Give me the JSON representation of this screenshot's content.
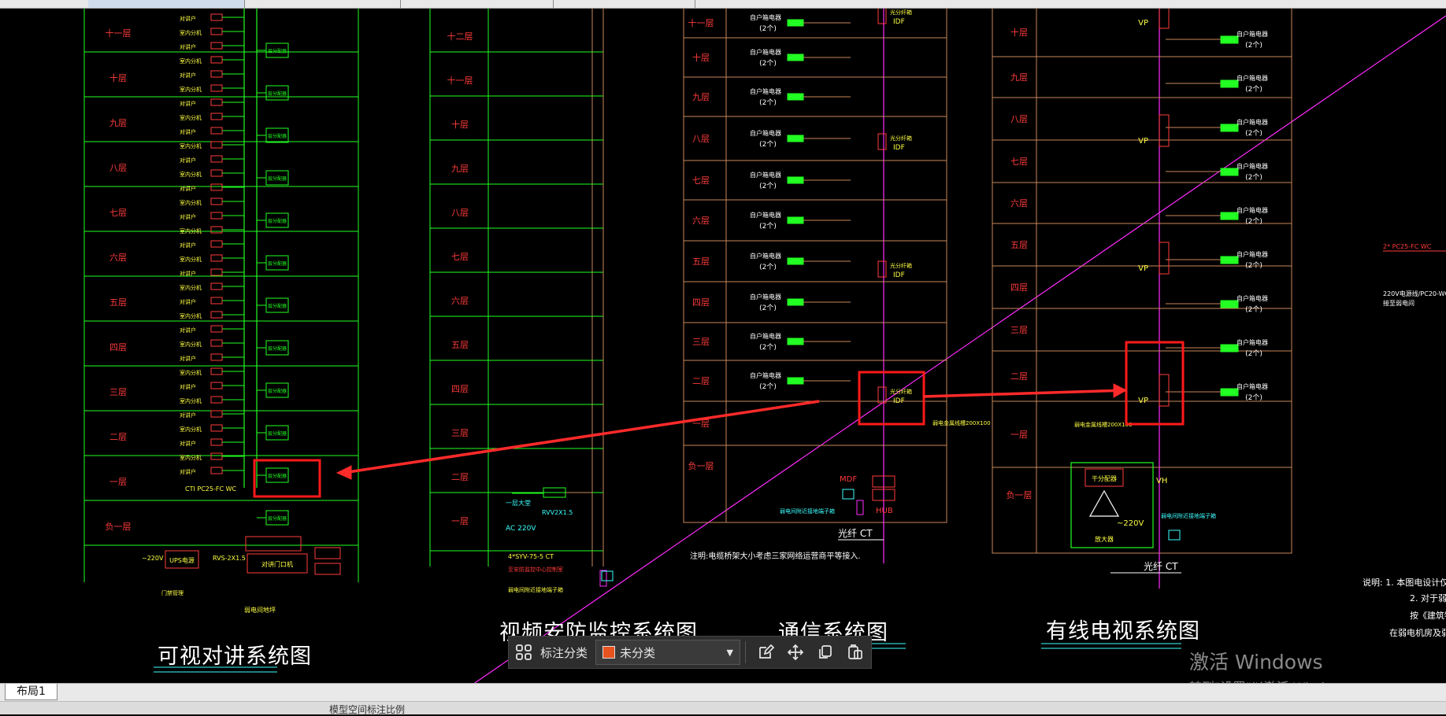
{
  "top_tabs": [
    "",
    "",
    "",
    "",
    ""
  ],
  "diagrams": {
    "intercom": {
      "title": "可视对讲系统图",
      "floors": [
        "十一层",
        "十层",
        "九层",
        "八层",
        "七层",
        "六层",
        "五层",
        "四层",
        "三层",
        "二层",
        "一层",
        "负一层"
      ],
      "component_labels": [
        "室内分机",
        "对讲户",
        "层分配器"
      ],
      "bottom_labels": [
        "UPS电源",
        "对讲门口机",
        "CTI PC25-FC WC",
        "楼层配电箱",
        "弱电间地坪",
        "RVS-2X1.5",
        "~220V",
        "门禁管理"
      ]
    },
    "cctv": {
      "title": "视频安防监控系统图",
      "floors": [
        "十二层",
        "十一层",
        "十层",
        "九层",
        "八层",
        "七层",
        "六层",
        "五层",
        "四层",
        "三层",
        "二层",
        "一层"
      ],
      "labels": [
        "一层大堂",
        "RVV2X1.5",
        "AC 220V",
        "4*SYV-75-5 CT",
        "至安防监控中心控制室",
        "弱电间附近接地端子箱"
      ]
    },
    "telecom": {
      "title": "通信系统图",
      "floors": [
        "十一层",
        "十层",
        "九层",
        "八层",
        "七层",
        "六层",
        "五层",
        "四层",
        "三层",
        "二层",
        "一层",
        "负一层"
      ],
      "outlet_label": "自户箱电器",
      "outlet_count": "(2个)",
      "idf_label": "IDF",
      "mdf_label": "MDF",
      "hub_label": "HUB",
      "tap_label": "光分纤箱",
      "note": "注明:电缆桥架大小考虑三家网络运营商平等接入.",
      "fiber_label": "光纤 CT",
      "riser_label": "弱电金属线槽200X100",
      "ground_label": "弱电间附近接地端子箱"
    },
    "catv": {
      "title": "有线电视系统图",
      "floors": [
        "十层",
        "九层",
        "八层",
        "七层",
        "六层",
        "五层",
        "四层",
        "三层",
        "二层",
        "一层",
        "负一层"
      ],
      "outlet_label": "自户箱电器",
      "outlet_count": "(2个)",
      "vp_label": "VP",
      "vh_label": "VH",
      "amp_label": "干分配器",
      "power_label": "~220V",
      "amp_box_label": "放大器",
      "fiber_label": "光纤 CT",
      "riser_label": "弱电金属线槽200X100",
      "ground_label": "弱电间附近接地端子箱"
    },
    "right_notes": [
      "2* PC25-FC WC",
      "220V电源线/PC20-WC",
      "接至弱电间",
      "说明: 1. 本图电设计仅为参",
      "2. 对于弱电系统电子",
      "按《建筑物电子信息",
      "在弱电机房及弱电间"
    ]
  },
  "context_toolbar": {
    "annotate_label": "标注分类",
    "category_value": "未分类",
    "category_color": "#e8531f"
  },
  "layout_tab": "布局1",
  "status_text": "模型空间标注比例",
  "watermark": {
    "line1": "激活 Windows",
    "line2": "转到\"设置\"以激活 Windows。"
  }
}
